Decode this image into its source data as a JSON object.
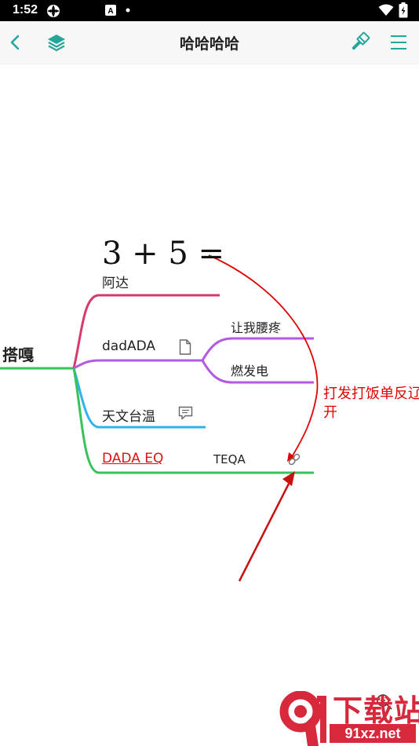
{
  "status_bar": {
    "time": "1:52"
  },
  "toolbar": {
    "title": "哈哈哈哈"
  },
  "mindmap": {
    "root": "搭嘎",
    "formula": "3 + 5 =",
    "branches": [
      {
        "label": "阿达"
      },
      {
        "label": "dadADA",
        "children": [
          "让我腰疼",
          "燃发电"
        ]
      },
      {
        "label": "天文台温"
      },
      {
        "label": "DADA EQ",
        "link_text": "TEQA"
      }
    ]
  },
  "annotation": {
    "line1": "打发打饭单反辽",
    "line2": "开"
  },
  "watermark": {
    "brand": "下载站",
    "domain": "91xz.net"
  },
  "colors": {
    "accent": "#26a69a",
    "branch_red": "#d63a6a",
    "branch_purple": "#b25be0",
    "branch_blue": "#2eb3f0",
    "branch_green": "#35c35a",
    "annotation_red": "#e00000"
  }
}
